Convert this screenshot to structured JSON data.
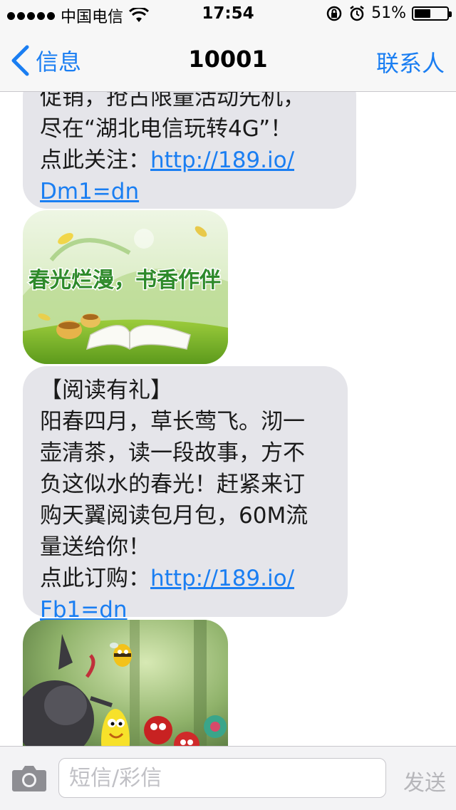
{
  "status_bar": {
    "carrier": "中国电信",
    "time": "17:54",
    "battery": "51%",
    "battery_level": 0.51,
    "icons": [
      "signal-dots-icon",
      "wifi-icon",
      "orientation-lock-icon",
      "alarm-icon",
      "battery-icon"
    ]
  },
  "nav": {
    "back_label": "信息",
    "title": "10001",
    "contact_label": "联系人"
  },
  "messages": [
    {
      "type": "text",
      "lines": [
        "促销，抢占限量活动先机，",
        "尽在“湖北电信玩转4G”！"
      ],
      "link_prefix": "点此关注：",
      "link_line1": "http://189.io/",
      "link_line2": "Dm1=dn"
    },
    {
      "type": "image",
      "image_text": "春光烂漫，书香作伴",
      "description_icon": "spring-reading-banner-image"
    },
    {
      "type": "text",
      "lines": [
        "【阅读有礼】",
        "阳春四月，草长莺飞。沏一",
        "壶清茶，读一段故事，方不",
        "负这似水的春光！赶紧来订",
        "购天翼阅读包月包，60M流",
        "量送给你！"
      ],
      "link_prefix": "点此订购：",
      "link_line1": "http://189.io/",
      "link_line2": "Fb1=dn"
    },
    {
      "type": "image",
      "description_icon": "cartoon-insects-image"
    }
  ],
  "input_bar": {
    "placeholder": "短信/彩信",
    "send_label": "发送"
  },
  "colors": {
    "accent": "#1a7ef2",
    "bubble": "#e5e5ea",
    "bar_bg": "#f7f7f7"
  }
}
